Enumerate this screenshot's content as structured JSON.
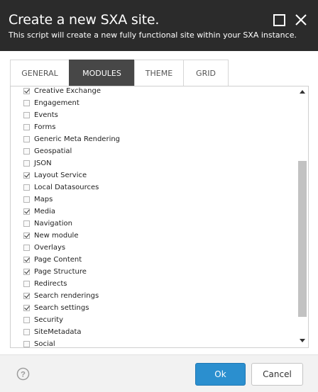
{
  "dialog": {
    "title": "Create a new SXA site.",
    "subtitle": "This script will create a new fully functional site within your SXA instance."
  },
  "tabs": [
    {
      "label": "GENERAL",
      "active": false
    },
    {
      "label": "MODULES",
      "active": true
    },
    {
      "label": "THEME",
      "active": false
    },
    {
      "label": "GRID",
      "active": false
    }
  ],
  "modules": [
    {
      "label": "Creative Exchange",
      "checked": true
    },
    {
      "label": "Engagement",
      "checked": false
    },
    {
      "label": "Events",
      "checked": false
    },
    {
      "label": "Forms",
      "checked": false
    },
    {
      "label": "Generic Meta Rendering",
      "checked": false
    },
    {
      "label": "Geospatial",
      "checked": false
    },
    {
      "label": "JSON",
      "checked": false
    },
    {
      "label": "Layout Service",
      "checked": true
    },
    {
      "label": "Local Datasources",
      "checked": false
    },
    {
      "label": "Maps",
      "checked": false
    },
    {
      "label": "Media",
      "checked": true
    },
    {
      "label": "Navigation",
      "checked": false
    },
    {
      "label": "New module",
      "checked": true
    },
    {
      "label": "Overlays",
      "checked": false
    },
    {
      "label": "Page Content",
      "checked": true
    },
    {
      "label": "Page Structure",
      "checked": true
    },
    {
      "label": "Redirects",
      "checked": false
    },
    {
      "label": "Search renderings",
      "checked": true
    },
    {
      "label": "Search settings",
      "checked": true
    },
    {
      "label": "Security",
      "checked": false
    },
    {
      "label": "SiteMetadata",
      "checked": false
    },
    {
      "label": "Social",
      "checked": false
    }
  ],
  "footer": {
    "ok_label": "Ok",
    "cancel_label": "Cancel"
  },
  "colors": {
    "header_bg": "#2b2b2b",
    "active_tab_bg": "#474747",
    "primary_button": "#2b8fcf"
  },
  "icons": {
    "maximize": "maximize-icon",
    "close": "close-icon",
    "help": "help-icon"
  }
}
